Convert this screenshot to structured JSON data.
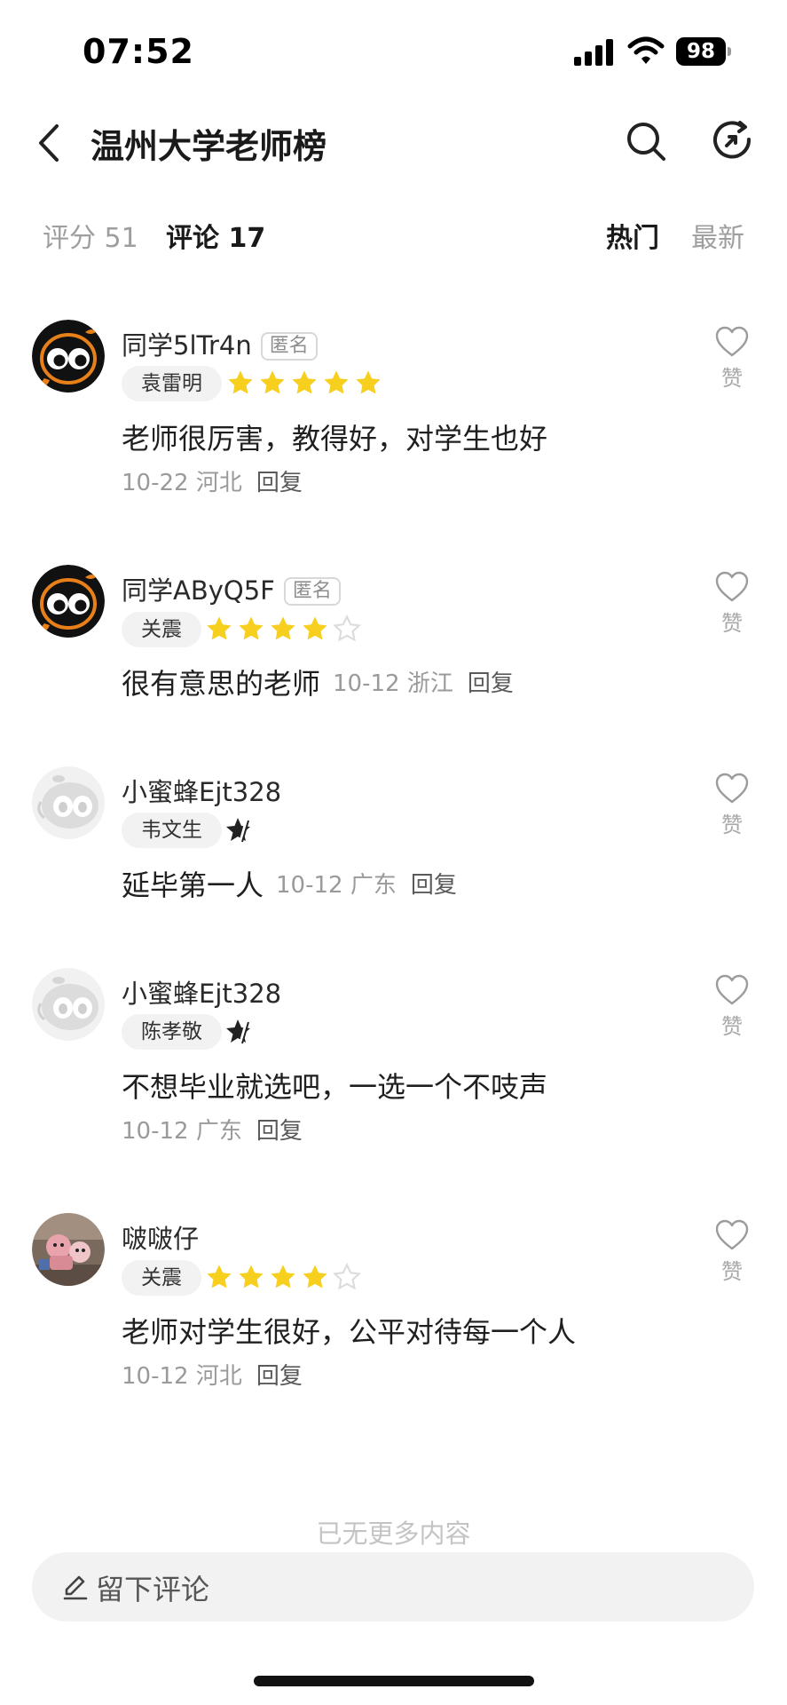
{
  "status_bar": {
    "time": "07:52",
    "battery": "98"
  },
  "header": {
    "title": "温州大学老师榜"
  },
  "tabs": {
    "rating": "评分 51",
    "comments": "评论 17",
    "sort_hot": "热门",
    "sort_new": "最新"
  },
  "comments": [
    {
      "user": "同学5lTr4n",
      "anonymous": "匿名",
      "teacher": "袁雷明",
      "stars": 5,
      "text": "老师很厉害，教得好，对学生也好",
      "date": "10-22",
      "location": "河北",
      "reply": "回复",
      "like": "赞"
    },
    {
      "user": "同学AByQ5F",
      "anonymous": "匿名",
      "teacher": "关震",
      "stars": 4,
      "text": "很有意思的老师",
      "date": "10-12",
      "location": "浙江",
      "reply": "回复",
      "like": "赞"
    },
    {
      "user": "小蜜蜂Ejt328",
      "teacher": "韦文生",
      "stars": 0,
      "text": "延毕第一人",
      "date": "10-12",
      "location": "广东",
      "reply": "回复",
      "like": "赞"
    },
    {
      "user": "小蜜蜂Ejt328",
      "teacher": "陈孝敬",
      "stars": 0,
      "text": "不想毕业就选吧，一选一个不吱声",
      "date": "10-12",
      "location": "广东",
      "reply": "回复",
      "like": "赞"
    },
    {
      "user": "啵啵仔",
      "teacher": "关震",
      "stars": 4,
      "text": "老师对学生很好，公平对待每一个人",
      "date": "10-12",
      "location": "河北",
      "reply": "回复",
      "like": "赞"
    }
  ],
  "footer": {
    "end_text": "已无更多内容",
    "comment_placeholder": "留下评论"
  },
  "colors": {
    "star": "#f7cf1f",
    "star_empty": "#dedede",
    "muted": "#9a9a9a"
  }
}
